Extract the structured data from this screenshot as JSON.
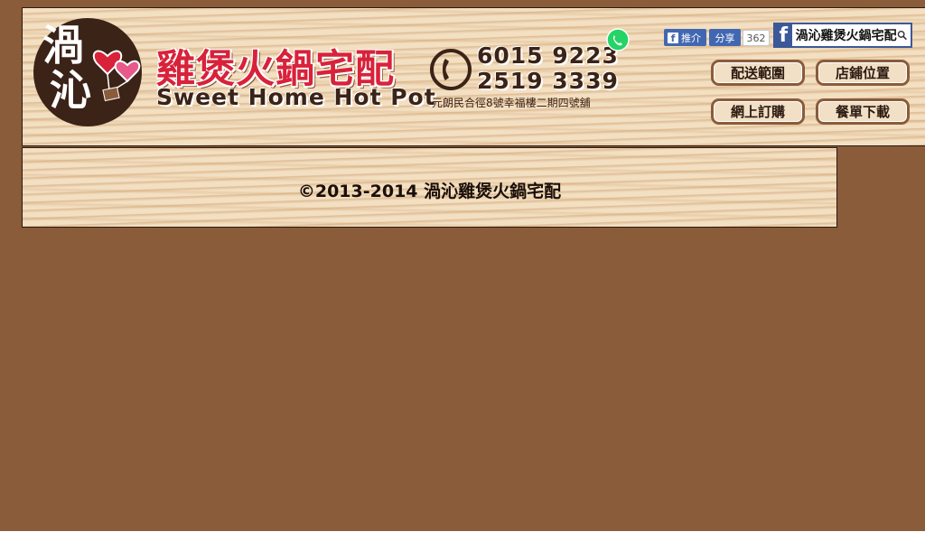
{
  "logo": {
    "char_top": "渦",
    "char_bottom": "沁"
  },
  "brand": {
    "name_cn": "雞煲火鍋宅配",
    "name_en": "Sweet Home Hot Pot"
  },
  "contact": {
    "phone_1": "6015 9223",
    "phone_2": "2519 3339",
    "address": "元朗民合徑8號幸福樓二期四號舖"
  },
  "facebook": {
    "like_label": "推介",
    "share_label": "分享",
    "count": "362",
    "page_name": "渦沁雞煲火鍋宅配"
  },
  "nav": {
    "delivery_area": "配送範圍",
    "store_location": "店鋪位置",
    "online_order": "網上訂購",
    "menu_download": "餐單下載"
  },
  "footer": {
    "copyright": "©2013-2014 渦沁雞煲火鍋宅配"
  },
  "colors": {
    "page_bg": "#8a5c3a",
    "wood": "#f3dfc2",
    "brand_red": "#d8223a",
    "dark_brown": "#3b2317",
    "facebook_blue": "#4267b2",
    "whatsapp_green": "#25d366"
  }
}
